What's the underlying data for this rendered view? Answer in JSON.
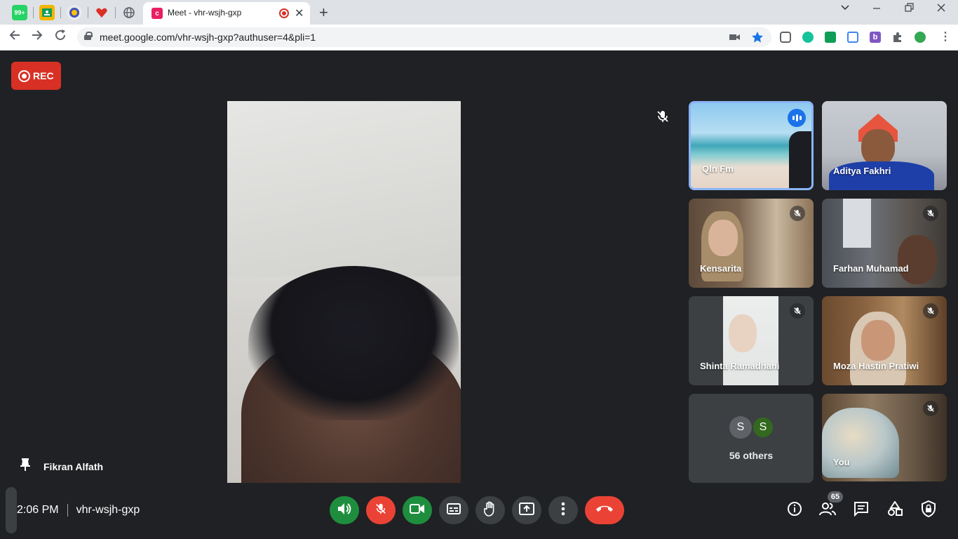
{
  "browser": {
    "pinned_tabs": [
      {
        "icon": "whatsapp-icon",
        "label": "99+",
        "color": "#25d366"
      },
      {
        "icon": "classroom-icon",
        "label": "",
        "color": "#f4b400"
      },
      {
        "icon": "school-logo-icon",
        "label": "",
        "color": "#3f51b5"
      },
      {
        "icon": "heart-icon",
        "label": "",
        "color": "#d93025"
      },
      {
        "icon": "globe-icon",
        "label": "",
        "color": "#5f6368"
      }
    ],
    "active_tab": {
      "title": "Meet - vhr-wsjh-gxp",
      "favicon_letter": "c"
    },
    "url": "meet.google.com/vhr-wsjh-gxp?authuser=4&pli=1"
  },
  "meet": {
    "rec_label": "REC",
    "pinned_name": "Fikran Alfath",
    "participants": [
      {
        "name": "Qln Fm",
        "muted": false,
        "speaking": true
      },
      {
        "name": "Aditya Fakhri",
        "muted": false,
        "speaking": false
      },
      {
        "name": "Kensarita",
        "muted": true,
        "speaking": false
      },
      {
        "name": "Farhan Muhamad",
        "muted": true,
        "speaking": false
      },
      {
        "name": "Shinta Ramadhani",
        "muted": true,
        "speaking": false
      },
      {
        "name": "Moza Hastin Pratiwi",
        "muted": true,
        "speaking": false
      },
      {
        "name": "You",
        "muted": true,
        "speaking": false
      }
    ],
    "others": {
      "avatars": [
        "S",
        "S"
      ],
      "label": "56 others"
    },
    "time": "2:06 PM",
    "meeting_code": "vhr-wsjh-gxp",
    "people_count": "65",
    "colors": {
      "accent_blue": "#1a73e8",
      "rec_red": "#d93025",
      "end_red": "#ea4335",
      "on_green": "#1e8e3e"
    }
  }
}
